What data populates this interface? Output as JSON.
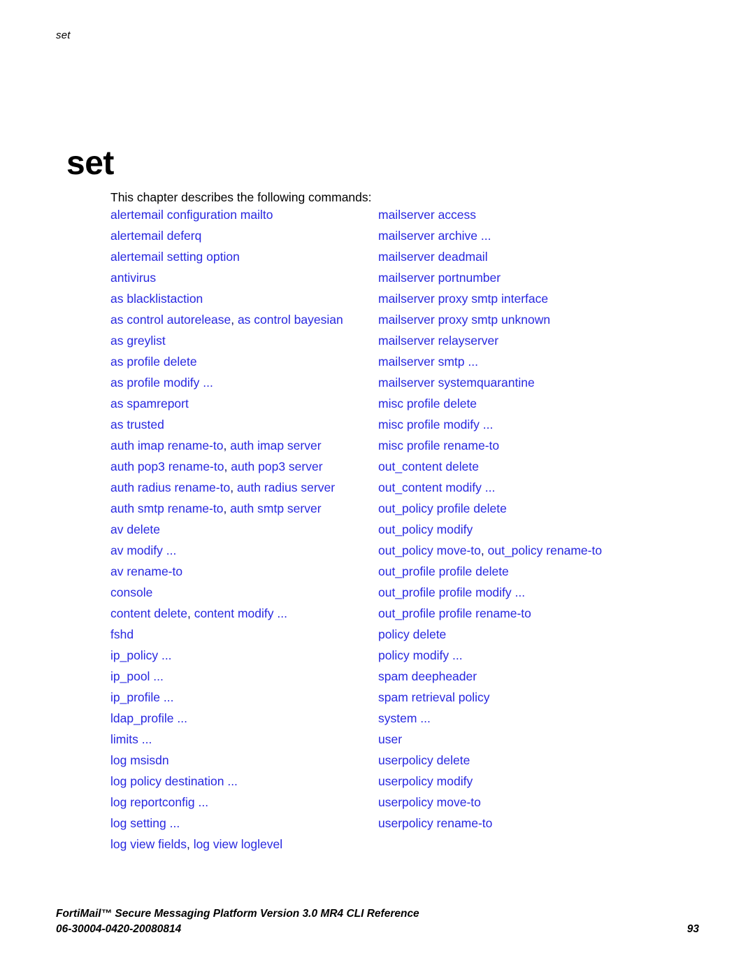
{
  "header": {
    "running_head": "set"
  },
  "title": "set",
  "intro": "This chapter describes the following commands:",
  "columns": {
    "left": [
      {
        "parts": [
          "alertemail configuration mailto"
        ]
      },
      {
        "parts": [
          "alertemail deferq"
        ]
      },
      {
        "parts": [
          "alertemail setting option"
        ]
      },
      {
        "parts": [
          "antivirus"
        ]
      },
      {
        "parts": [
          "as blacklistaction"
        ]
      },
      {
        "parts": [
          "as control autorelease",
          "as control bayesian"
        ]
      },
      {
        "parts": [
          "as greylist"
        ]
      },
      {
        "parts": [
          "as profile delete"
        ]
      },
      {
        "parts": [
          "as profile modify ..."
        ]
      },
      {
        "parts": [
          "as spamreport"
        ]
      },
      {
        "parts": [
          "as trusted"
        ]
      },
      {
        "parts": [
          "auth imap rename-to",
          "auth imap server"
        ]
      },
      {
        "parts": [
          "auth pop3 rename-to",
          "auth pop3 server"
        ]
      },
      {
        "parts": [
          "auth radius rename-to",
          "auth radius server"
        ]
      },
      {
        "parts": [
          "auth smtp rename-to",
          "auth smtp server"
        ]
      },
      {
        "parts": [
          "av delete"
        ]
      },
      {
        "parts": [
          "av modify ..."
        ]
      },
      {
        "parts": [
          "av rename-to"
        ]
      },
      {
        "parts": [
          "console"
        ]
      },
      {
        "parts": [
          "content delete",
          "content modify ..."
        ]
      },
      {
        "parts": [
          "fshd"
        ]
      },
      {
        "parts": [
          "ip_policy ..."
        ]
      },
      {
        "parts": [
          "ip_pool ..."
        ]
      },
      {
        "parts": [
          "ip_profile ..."
        ]
      },
      {
        "parts": [
          "ldap_profile ..."
        ]
      },
      {
        "parts": [
          "limits ..."
        ]
      },
      {
        "parts": [
          "log msisdn"
        ]
      },
      {
        "parts": [
          "log policy destination ..."
        ]
      },
      {
        "parts": [
          "log reportconfig ..."
        ]
      },
      {
        "parts": [
          "log setting ..."
        ]
      },
      {
        "parts": [
          "log view fields",
          "log view loglevel"
        ]
      }
    ],
    "right": [
      {
        "parts": [
          "mailserver access"
        ]
      },
      {
        "parts": [
          "mailserver archive ..."
        ]
      },
      {
        "parts": [
          "mailserver deadmail"
        ]
      },
      {
        "parts": [
          "mailserver portnumber"
        ]
      },
      {
        "parts": [
          "mailserver proxy smtp interface"
        ]
      },
      {
        "parts": [
          "mailserver proxy smtp unknown"
        ]
      },
      {
        "parts": [
          "mailserver relayserver"
        ]
      },
      {
        "parts": [
          "mailserver smtp ..."
        ]
      },
      {
        "parts": [
          "mailserver systemquarantine"
        ]
      },
      {
        "parts": [
          "misc profile delete"
        ]
      },
      {
        "parts": [
          "misc profile modify ..."
        ]
      },
      {
        "parts": [
          "misc profile rename-to"
        ]
      },
      {
        "parts": [
          "out_content delete"
        ]
      },
      {
        "parts": [
          "out_content modify ..."
        ]
      },
      {
        "parts": [
          "out_policy profile delete"
        ]
      },
      {
        "parts": [
          "out_policy modify"
        ]
      },
      {
        "parts": [
          "out_policy move-to",
          "out_policy rename-to"
        ]
      },
      {
        "parts": [
          "out_profile profile delete"
        ]
      },
      {
        "parts": [
          "out_profile profile modify ..."
        ]
      },
      {
        "parts": [
          "out_profile profile rename-to"
        ]
      },
      {
        "parts": [
          "policy delete"
        ]
      },
      {
        "parts": [
          "policy modify ..."
        ]
      },
      {
        "parts": [
          "spam deepheader"
        ]
      },
      {
        "parts": [
          "spam retrieval policy"
        ]
      },
      {
        "parts": [
          "system ..."
        ]
      },
      {
        "parts": [
          "user"
        ]
      },
      {
        "parts": [
          "userpolicy delete"
        ]
      },
      {
        "parts": [
          "userpolicy modify"
        ]
      },
      {
        "parts": [
          "userpolicy move-to"
        ]
      },
      {
        "parts": [
          "userpolicy rename-to"
        ]
      }
    ]
  },
  "separator": ", ",
  "footer": {
    "line1": "FortiMail™ Secure Messaging Platform Version 3.0 MR4 CLI Reference",
    "line2": "06-30004-0420-20080814",
    "page_number": "93"
  },
  "colors": {
    "link": "#2828e0",
    "text": "#000000",
    "background": "#ffffff"
  }
}
